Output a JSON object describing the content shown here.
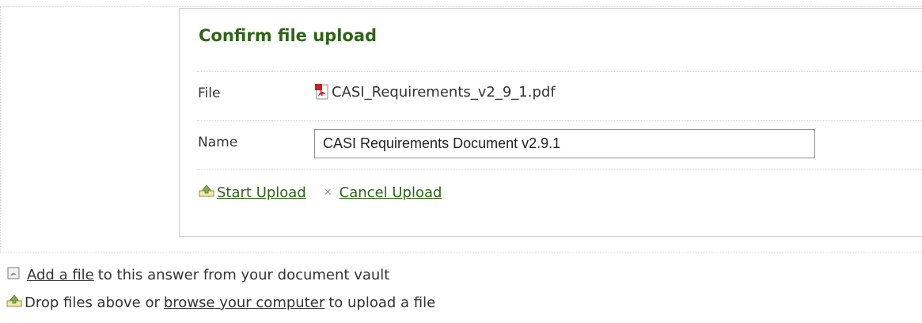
{
  "panel": {
    "title": "Confirm file upload",
    "file_label": "File",
    "file_name": "CASI_Requirements_v2_9_1.pdf",
    "name_label": "Name",
    "name_value": "CASI Requirements Document v2.9.1",
    "start_upload": "Start Upload",
    "cancel_upload": "Cancel Upload"
  },
  "footer": {
    "add_link": "Add a file",
    "add_rest": "to this answer from your document vault",
    "drop_prefix": "Drop files above or",
    "browse_link": "browse your computer",
    "drop_suffix": "to upload a file"
  },
  "icons": {
    "file_type": "pdf-icon",
    "start": "upload-icon",
    "cancel": "cancel-icon",
    "vault": "document-icon",
    "browse": "upload-icon"
  },
  "colors": {
    "accent": "#2e6417",
    "pdf_red": "#cc1f1f"
  }
}
